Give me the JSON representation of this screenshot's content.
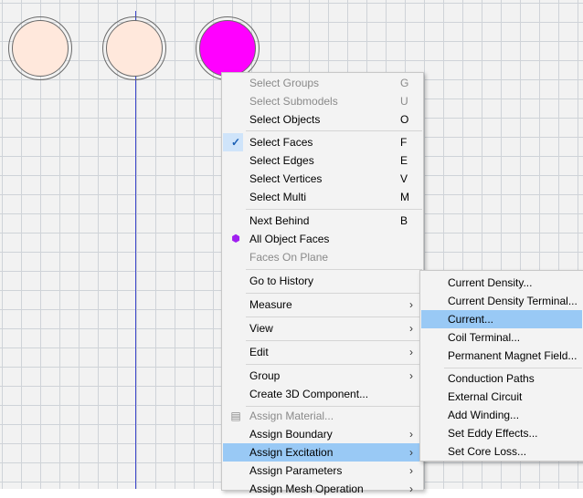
{
  "context_menu": {
    "items": [
      {
        "label": "Select Groups",
        "shortcut": "G",
        "disabled": true
      },
      {
        "label": "Select Submodels",
        "shortcut": "U",
        "disabled": true
      },
      {
        "label": "Select Objects",
        "shortcut": "O"
      },
      {
        "label": "Select Faces",
        "shortcut": "F",
        "checked": true
      },
      {
        "label": "Select Edges",
        "shortcut": "E"
      },
      {
        "label": "Select Vertices",
        "shortcut": "V"
      },
      {
        "label": "Select Multi",
        "shortcut": "M"
      },
      {
        "label": "Next Behind",
        "shortcut": "B"
      },
      {
        "label": "All Object Faces",
        "icon": "purple-cube-icon"
      },
      {
        "label": "Faces On Plane",
        "disabled": true
      },
      {
        "label": "Go to History"
      },
      {
        "label": "Measure",
        "submenu": true
      },
      {
        "label": "View",
        "submenu": true
      },
      {
        "label": "Edit",
        "submenu": true
      },
      {
        "label": "Group",
        "submenu": true
      },
      {
        "label": "Create 3D Component..."
      },
      {
        "label": "Assign Material...",
        "disabled": true,
        "icon": "material-stack-icon"
      },
      {
        "label": "Assign Boundary",
        "submenu": true
      },
      {
        "label": "Assign Excitation",
        "submenu": true,
        "highlighted": true
      },
      {
        "label": "Assign Parameters",
        "submenu": true
      },
      {
        "label": "Assign Mesh Operation",
        "submenu": true
      }
    ]
  },
  "excitation_submenu": {
    "items": [
      {
        "label": "Current Density..."
      },
      {
        "label": "Current Density Terminal..."
      },
      {
        "label": "Current...",
        "highlighted": true
      },
      {
        "label": "Coil Terminal..."
      },
      {
        "label": "Permanent Magnet Field..."
      },
      {
        "label": "Conduction Paths"
      },
      {
        "label": "External Circuit"
      },
      {
        "label": "Add Winding..."
      },
      {
        "label": "Set Eddy Effects..."
      },
      {
        "label": "Set Core Loss..."
      }
    ]
  },
  "colors": {
    "selected_face": "#ff00ff",
    "circle_fill": "#ffe8dc",
    "highlight": "#99c9f5",
    "axis_line": "#3f48cc"
  },
  "glyphs": {
    "check": "✓",
    "arrow": "›",
    "cube": "⬢",
    "stack": "▤"
  }
}
